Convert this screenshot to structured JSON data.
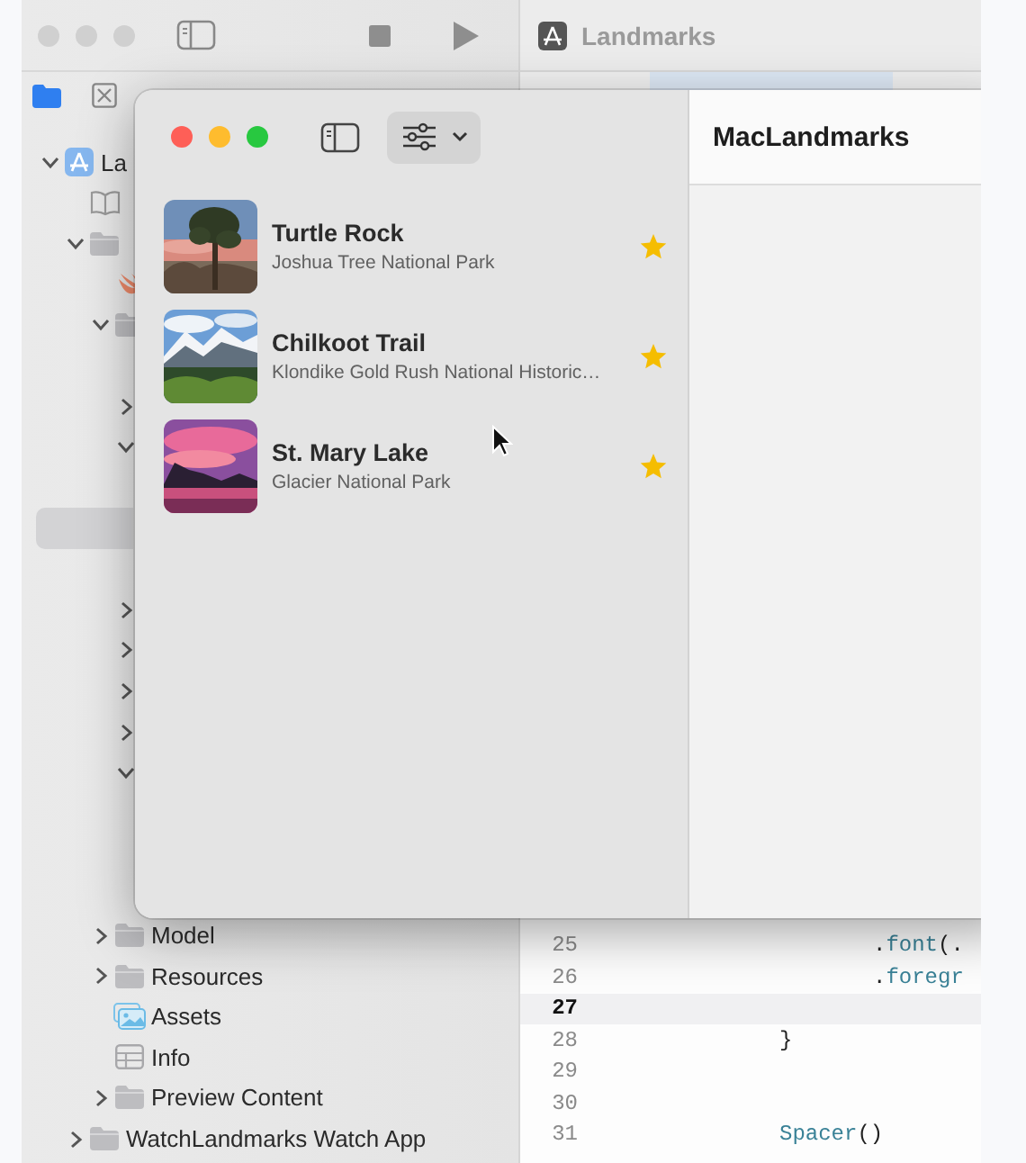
{
  "xcode": {
    "title": "Landmarks",
    "navigator": {
      "tree": [
        {
          "label": "La",
          "kind": "app",
          "expanded": true,
          "selected": false,
          "children": [
            {
              "kind": "book",
              "selected": false
            },
            {
              "kind": "folder",
              "expanded": true,
              "selected": false,
              "children": [
                {
                  "kind": "bird",
                  "selected": false
                },
                {
                  "kind": "folder",
                  "expanded": true,
                  "selected": false,
                  "children": [
                    {
                      "selected": false
                    },
                    {
                      "expanded": false,
                      "selected": false
                    },
                    {
                      "expanded": true,
                      "selected": false,
                      "children": [
                        {
                          "selected": false
                        },
                        {
                          "selected": true
                        },
                        {
                          "selected": false
                        }
                      ]
                    },
                    {
                      "expanded": false,
                      "selected": false
                    },
                    {
                      "expanded": false,
                      "selected": false
                    },
                    {
                      "expanded": false,
                      "selected": false
                    },
                    {
                      "expanded": false,
                      "selected": false
                    },
                    {
                      "expanded": true,
                      "selected": false,
                      "children": [
                        {
                          "selected": false
                        },
                        {
                          "selected": false
                        },
                        {
                          "selected": false
                        }
                      ]
                    }
                  ]
                },
                {
                  "label": "Model",
                  "kind": "folder",
                  "expanded": false,
                  "selected": false
                },
                {
                  "label": "Resources",
                  "kind": "folder",
                  "expanded": false,
                  "selected": false
                },
                {
                  "label": "Assets",
                  "kind": "images",
                  "selected": false
                },
                {
                  "label": "Info",
                  "kind": "table",
                  "selected": false
                },
                {
                  "label": "Preview Content",
                  "kind": "folder",
                  "expanded": false,
                  "selected": false
                }
              ]
            },
            {
              "label": "WatchLandmarks Watch App",
              "kind": "folder",
              "expanded": false,
              "selected": false
            }
          ]
        }
      ]
    },
    "editor": {
      "lines": [
        {
          "number": "25",
          "current": false,
          "kind": "modifier",
          "parts": [
            {
              "text": ".",
              "kind": "plain"
            },
            {
              "text": "font",
              "kind": "call"
            },
            {
              "text": "(.",
              "kind": "plain"
            }
          ]
        },
        {
          "number": "26",
          "current": false,
          "kind": "modifier",
          "parts": [
            {
              "text": ".",
              "kind": "plain"
            },
            {
              "text": "foregr",
              "kind": "call"
            }
          ]
        },
        {
          "number": "27",
          "current": true
        },
        {
          "number": "28",
          "current": false,
          "kind": "statement",
          "parts": [
            {
              "text": "}",
              "kind": "plain"
            }
          ]
        },
        {
          "number": "29",
          "current": false
        },
        {
          "number": "30",
          "current": false
        },
        {
          "number": "31",
          "current": false,
          "kind": "statement",
          "parts": [
            {
              "text": "Spacer",
              "kind": "call"
            },
            {
              "text": "()",
              "kind": "plain"
            }
          ]
        }
      ]
    }
  },
  "app": {
    "sidebar": {
      "landmarks": [
        {
          "name": "Turtle Rock",
          "park": "Joshua Tree National Park",
          "favorite": true
        },
        {
          "name": "Chilkoot Trail",
          "park": "Klondike Gold Rush National Historic…",
          "favorite": true
        },
        {
          "name": "St. Mary Lake",
          "park": "Glacier National Park",
          "favorite": true
        }
      ]
    },
    "detail": {
      "title": "MacLandmarks"
    }
  }
}
